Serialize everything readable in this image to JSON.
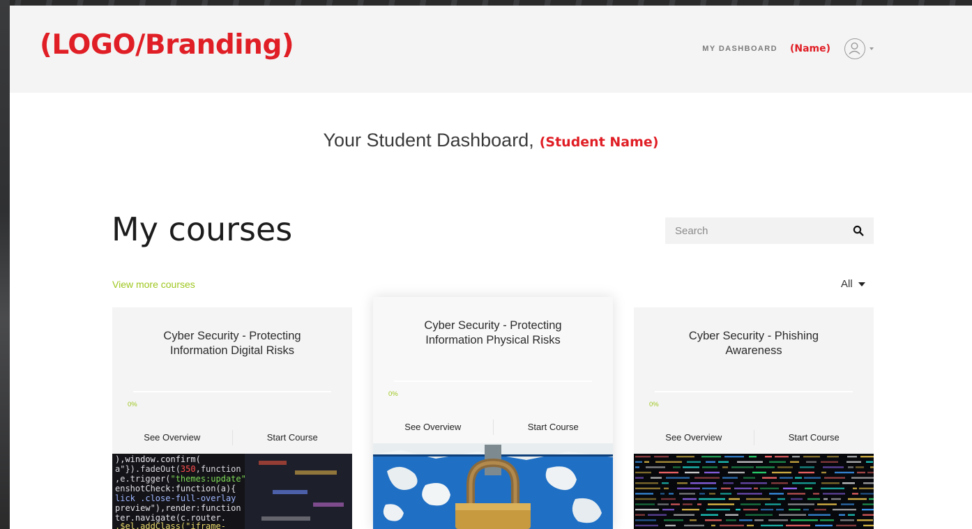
{
  "header": {
    "logo_text": "(LOGO/Branding)",
    "nav_dashboard": "MY DASHBOARD",
    "nav_name": "(Name)",
    "avatar_icon": "user-circle-icon"
  },
  "welcome": {
    "text": "Your Student Dashboard,",
    "student_name": "(Student Name)"
  },
  "courses": {
    "heading": "My courses",
    "search_placeholder": "Search",
    "view_more": "View more courses",
    "filter_selected": "All",
    "items": [
      {
        "title": "Cyber Security - Protecting Information Digital Risks",
        "progress": 0,
        "progress_label": "0%",
        "overview_label": "See Overview",
        "start_label": "Start Course",
        "image": "code-screen-photo"
      },
      {
        "title": "Cyber Security - Protecting Information Physical Risks",
        "progress": 0,
        "progress_label": "0%",
        "overview_label": "See Overview",
        "start_label": "Start Course",
        "image": "padlock-photo"
      },
      {
        "title": "Cyber Security - Phishing Awareness",
        "progress": 0,
        "progress_label": "0%",
        "overview_label": "See Overview",
        "start_label": "Start Course",
        "image": "matrix-code-photo"
      }
    ]
  },
  "colors": {
    "brand_red": "#e01e25",
    "accent_green": "#9dc61d",
    "topbar_bg": "#f4f4f4"
  }
}
